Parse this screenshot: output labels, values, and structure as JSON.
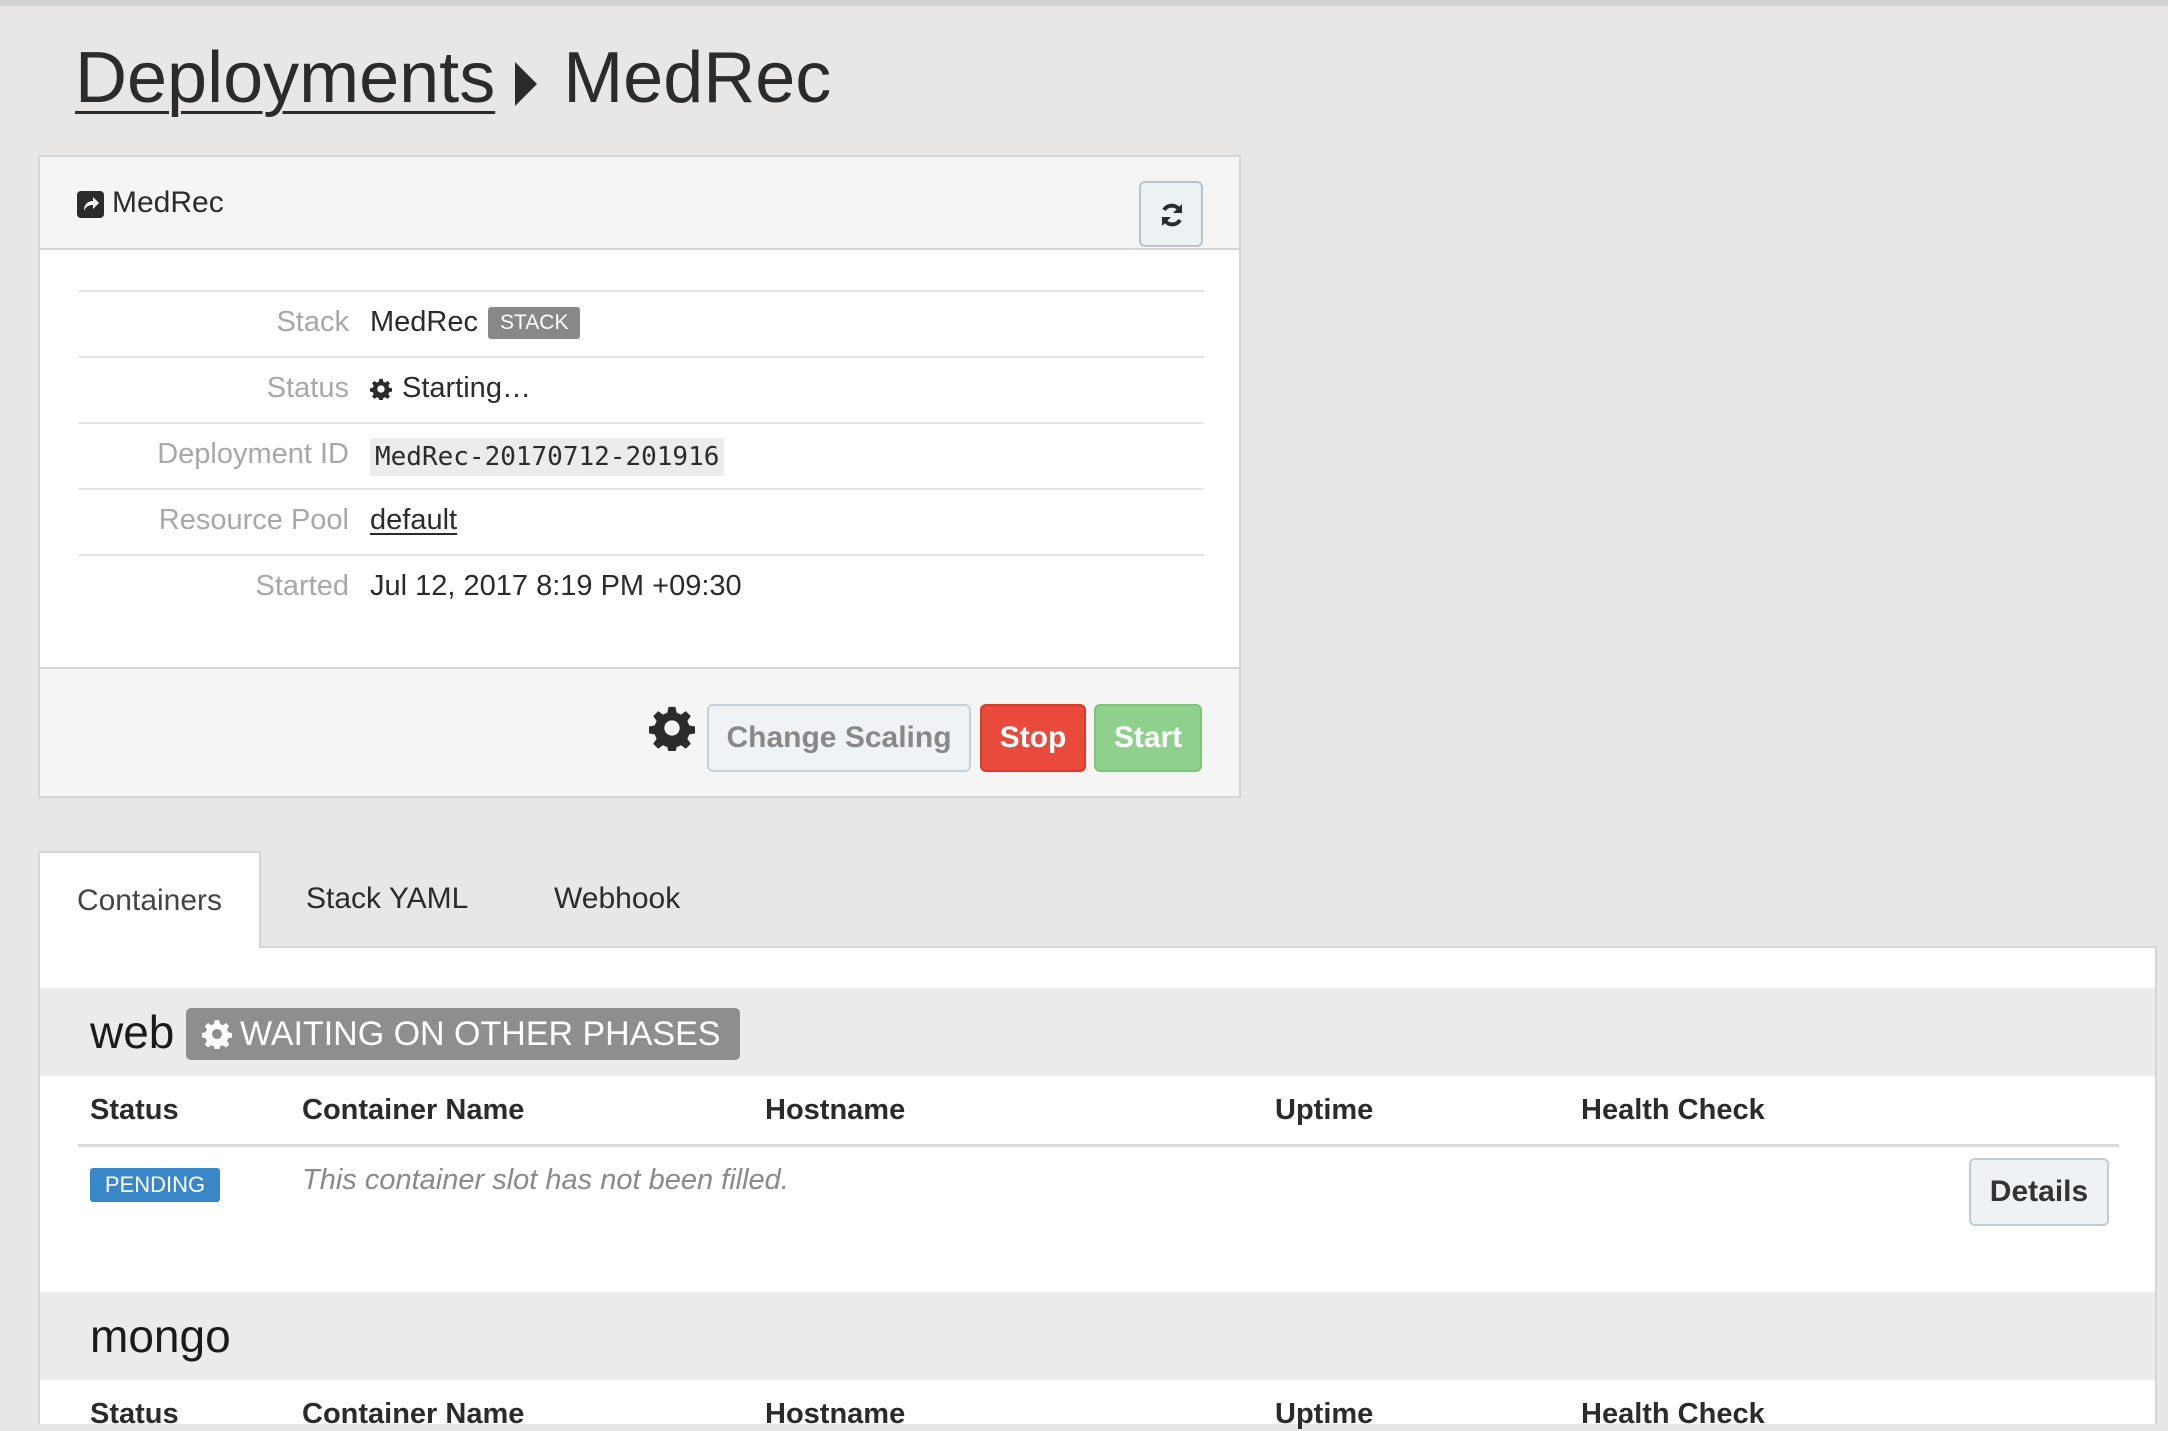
{
  "breadcrumb": {
    "root": "Deployments",
    "current": "MedRec"
  },
  "panel": {
    "title": "MedRec",
    "rows": [
      {
        "label": "Stack",
        "value": "MedRec",
        "badge": "STACK"
      },
      {
        "label": "Status",
        "value": "Starting…"
      },
      {
        "label": "Deployment ID",
        "value": "MedRec-20170712-201916"
      },
      {
        "label": "Resource Pool",
        "value": "default"
      },
      {
        "label": "Started",
        "value": "Jul 12, 2017 8:19 PM +09:30"
      }
    ],
    "actions": {
      "scale": "Change Scaling",
      "stop": "Stop",
      "start": "Start"
    }
  },
  "tabs": [
    "Containers",
    "Stack YAML",
    "Webhook"
  ],
  "columns": [
    "Status",
    "Container Name",
    "Hostname",
    "Uptime",
    "Health Check"
  ],
  "services": [
    {
      "name": "web",
      "phase": "WAITING ON OTHER PHASES",
      "row": {
        "status": "PENDING",
        "message": "This container slot has not been filled.",
        "details": "Details"
      }
    },
    {
      "name": "mongo"
    }
  ],
  "colors": {
    "stop": "#ea4a3b",
    "start": "#8fd08d",
    "pending": "#3a87c8",
    "phase_badge": "#8e8e8e"
  },
  "icons": [
    "share-icon",
    "refresh-icon",
    "gear-icon"
  ]
}
